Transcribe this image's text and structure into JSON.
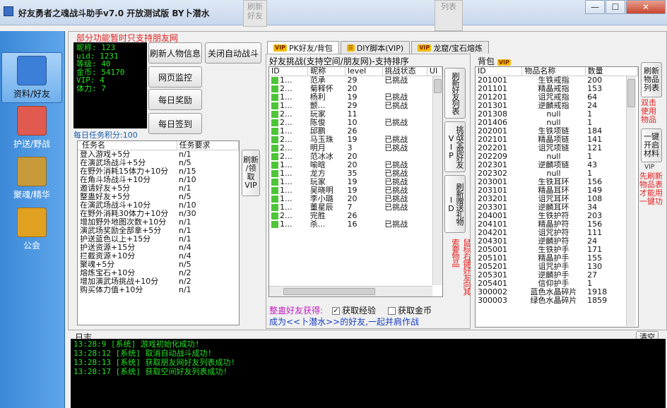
{
  "window": {
    "title": "好友勇者之魂战斗助手v7.0 开放测试版 BY卜潜水",
    "min": "—",
    "max": "☐",
    "close": "✕",
    "ghost_right": "列表",
    "ghost_left": "刷新\n好友"
  },
  "sidebar": {
    "items": [
      {
        "label": "资料/好友",
        "icon": "home-icon",
        "color": "#3b7fd9"
      },
      {
        "label": "护送/野战",
        "icon": "escort-icon",
        "color": "#e05a4f"
      },
      {
        "label": "聚魂/精华",
        "icon": "soul-icon",
        "color": "#c89a3a"
      },
      {
        "label": "公会",
        "icon": "guild-icon",
        "color": "#e0a020"
      }
    ]
  },
  "profile": {
    "notice": "部分功能暂时只支持朋友网",
    "lines": [
      "昵称: 123",
      "uid: 1231",
      "等级: 40",
      "金币: 54170",
      "VIP: 4",
      "体力: 7"
    ],
    "score": "每日任务积分:100"
  },
  "buttons": {
    "refresh_info": "刷新人物信息",
    "close_auto": "关闭自动战斗",
    "web_monitor": "网页监控",
    "daily_reward": "每日奖励",
    "daily_signin": "每日签到",
    "refresh_claim_vip": "刷新\n/领\n取\nVIP"
  },
  "tasks": {
    "headers": [
      "任务名",
      "任务要求"
    ],
    "rows": [
      [
        "登入游戏+5分",
        "n/1"
      ],
      [
        "在演武场战斗+5分",
        "n/5"
      ],
      [
        "在野外消耗15体力+10分",
        "n/15"
      ],
      [
        "在角斗场战斗+10分",
        "n/10"
      ],
      [
        "邀请好友+5分",
        "n/1"
      ],
      [
        "整蛊好友+5分",
        "n/5"
      ],
      [
        "在演武场战斗+10分",
        "n/10"
      ],
      [
        "在野外消耗30体力+10分",
        "n/30"
      ],
      [
        "增加野外地图次数+10分",
        "n/1"
      ],
      [
        "演武场奖励全部拿+5分",
        "n/1"
      ],
      [
        "护送蓝色以上+15分",
        "n/1"
      ],
      [
        "护送资源+15分",
        "n/4"
      ],
      [
        "拦截资源+10分",
        "n/4"
      ],
      [
        "聚魂+5分",
        "n/5"
      ],
      [
        "熔炼宝石+10分",
        "n/2"
      ],
      [
        "增加演武场挑战+10分",
        "n/2"
      ],
      [
        "购买体力值+10分",
        "n/1"
      ]
    ]
  },
  "tabs": [
    {
      "label": "PK好友/背包",
      "vip": "VIP",
      "active": true
    },
    {
      "label": "DIY脚本(VIP)",
      "vip": "",
      "active": false
    },
    {
      "label": "龙窟/宝石熔炼",
      "vip": "VIP",
      "active": false
    }
  ],
  "friends": {
    "title": "好友挑战(支持空间/朋友网)-支持排序",
    "headers": [
      "ID",
      "昵称",
      "level",
      "挑战状态",
      "UI"
    ],
    "rows": [
      [
        "1...",
        "范承",
        "29",
        "已挑战"
      ],
      [
        "2...",
        "菊释怀",
        "20",
        ""
      ],
      [
        "1...",
        "杨利",
        "19",
        "已挑战"
      ],
      [
        "1...",
        "颤...",
        "29",
        "已挑战"
      ],
      [
        "2...",
        "玩家",
        "11",
        ""
      ],
      [
        "2...",
        "陈俊",
        "10",
        "已挑战"
      ],
      [
        "1...",
        "邱鹏",
        "26",
        ""
      ],
      [
        "2...",
        "马玉珠",
        "19",
        "已挑战"
      ],
      [
        "2...",
        "明月",
        "3",
        "已挑战"
      ],
      [
        "2...",
        "范冰冰",
        "20",
        ""
      ],
      [
        "1...",
        "喻晗",
        "20",
        "已挑战"
      ],
      [
        "1...",
        "龙方",
        "35",
        "已挑战"
      ],
      [
        "1...",
        "玩家",
        "19",
        "已挑战"
      ],
      [
        "1...",
        "吴晓明",
        "19",
        "已挑战"
      ],
      [
        "1...",
        "李小璐",
        "20",
        "已挑战"
      ],
      [
        "1...",
        "董星辰",
        "7",
        "已挑战"
      ],
      [
        "2...",
        "完胜",
        "26",
        ""
      ],
      [
        "1...",
        "杀...",
        "16",
        "已挑战"
      ]
    ],
    "side_buttons": [
      "刷新好友列表",
      "挑战全部好友VIP",
      "刷新赠送礼物ID"
    ],
    "tip": "鼠标右键好友向其索要物品",
    "prank_label": "整蛊好友获得:",
    "opt_exp": "获取经验",
    "opt_gold": "获取金币",
    "opt_exp_checked": "✓",
    "invite": "成为<<卜潜水>>的好友,一起并肩作战"
  },
  "bag": {
    "title": "背包",
    "vip": "VIP",
    "headers": [
      "ID",
      "物品名称",
      "数量"
    ],
    "rows": [
      [
        "201001",
        "生铁戒指",
        "200"
      ],
      [
        "201101",
        "精晶戒指",
        "153"
      ],
      [
        "201201",
        "诅咒戒指",
        "64"
      ],
      [
        "201301",
        "逆麟戒指",
        "24"
      ],
      [
        "201308",
        "null",
        "1"
      ],
      [
        "201406",
        "null",
        "1"
      ],
      [
        "202001",
        "生铁项链",
        "184"
      ],
      [
        "202101",
        "精晶项链",
        "141"
      ],
      [
        "202201",
        "诅咒项链",
        "121"
      ],
      [
        "202209",
        "null",
        "1"
      ],
      [
        "202301",
        "逆麟项链",
        "43"
      ],
      [
        "202302",
        "null",
        "1"
      ],
      [
        "203001",
        "生铁耳环",
        "156"
      ],
      [
        "203101",
        "精晶耳环",
        "149"
      ],
      [
        "203201",
        "诅咒耳环",
        "108"
      ],
      [
        "203301",
        "逆麟耳环",
        "34"
      ],
      [
        "204001",
        "生铁护符",
        "203"
      ],
      [
        "204101",
        "精晶护符",
        "156"
      ],
      [
        "204201",
        "诅咒护符",
        "111"
      ],
      [
        "204301",
        "逆麟护符",
        "24"
      ],
      [
        "205001",
        "生铁护手",
        "171"
      ],
      [
        "205101",
        "精晶护手",
        "155"
      ],
      [
        "205201",
        "诅咒护手",
        "130"
      ],
      [
        "205301",
        "逆麟护手",
        "27"
      ],
      [
        "205401",
        "信仰护手",
        "1"
      ],
      [
        "300002",
        "蓝色水晶碎片",
        "1918"
      ],
      [
        "300003",
        "绿色水晶碎片",
        "1859"
      ]
    ],
    "btn_refresh": "刷新物品列表",
    "tip_double": "双击使用物品",
    "btn_open": "一键开启材料",
    "vip_tag": "VIP",
    "tip_refresh": "先刷新物品表才能用一键功"
  },
  "log": {
    "title": "日志",
    "clear": "清空",
    "lines": [
      "13:28:9 [系统] 游戏初始化成功!",
      "13:28:12 [系统] 取消自动战斗成功!",
      "13:28:13 [系统] 获取朋友网好友列表成功!",
      "13:28:17 [系统] 获取空间好友列表成功!"
    ]
  }
}
